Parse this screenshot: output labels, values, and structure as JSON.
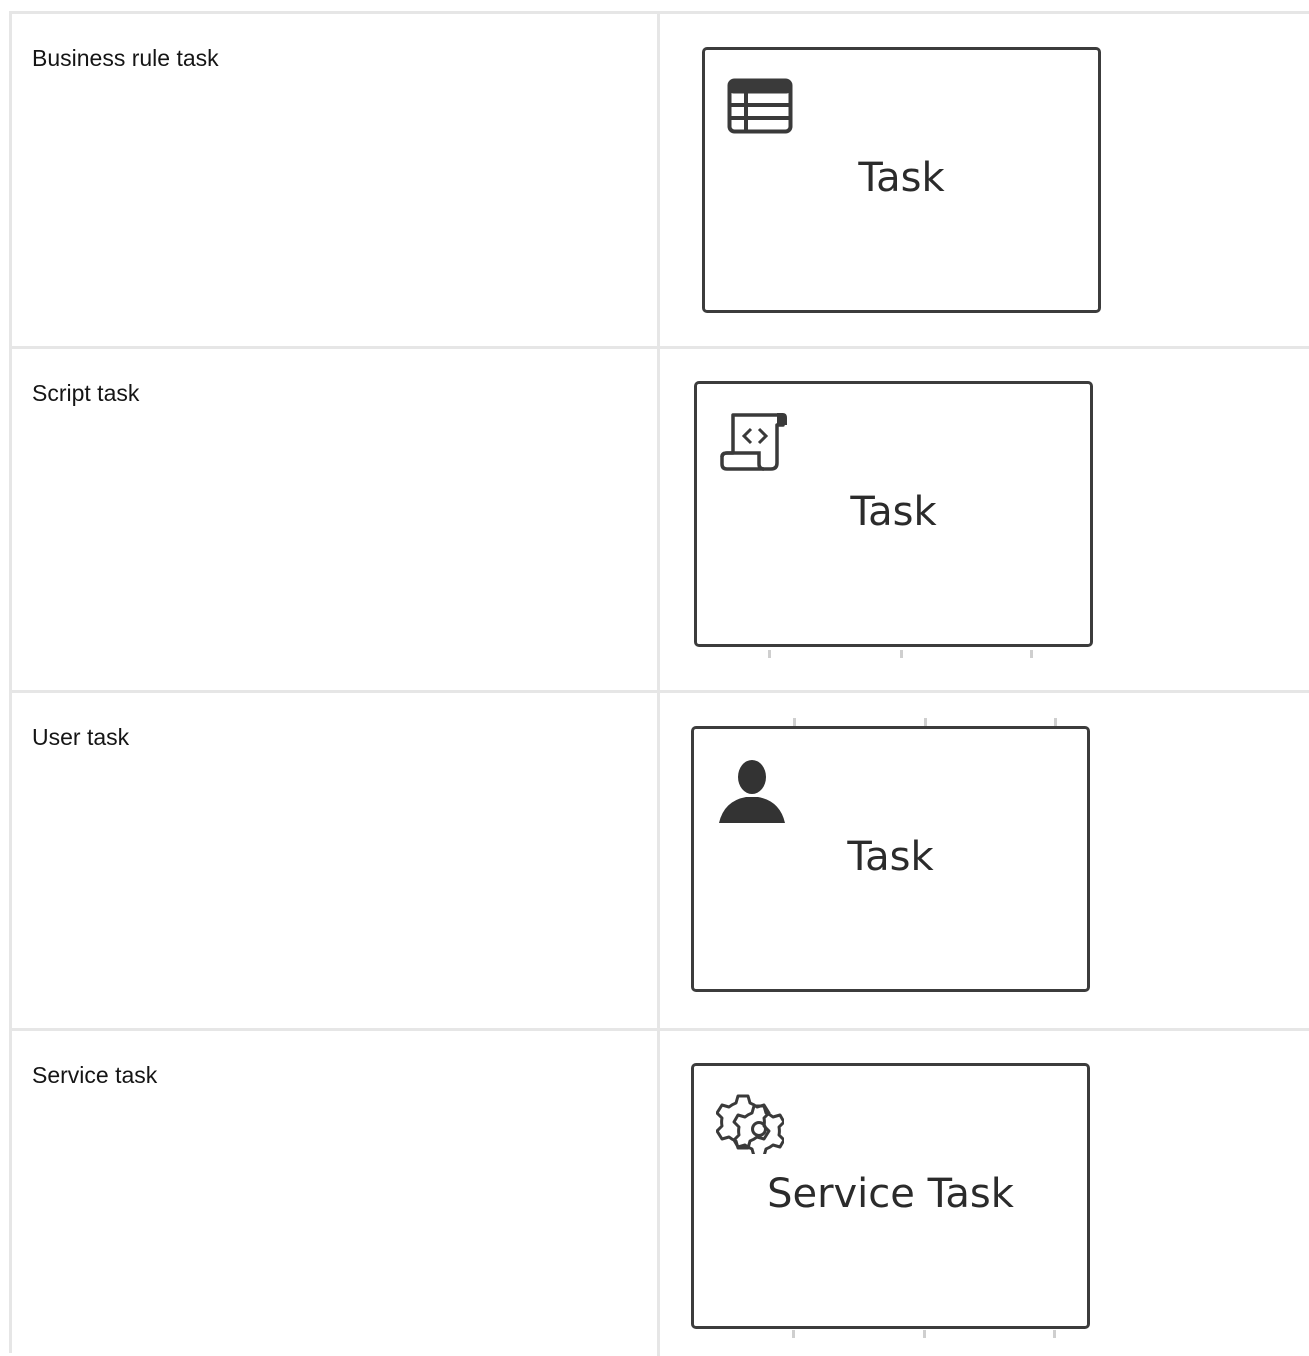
{
  "rows": [
    {
      "label": "Business rule task",
      "figure_label": "Task",
      "icon": "business-rule-table-icon"
    },
    {
      "label": "Script task",
      "figure_label": "Task",
      "icon": "script-scroll-icon"
    },
    {
      "label": "User task",
      "figure_label": "Task",
      "icon": "user-icon"
    },
    {
      "label": "Service task",
      "figure_label": "Service Task",
      "icon": "gear-icon"
    }
  ],
  "colors": {
    "border": "#e6e6e6",
    "task_stroke": "#3c3c3c",
    "text": "#151515"
  }
}
